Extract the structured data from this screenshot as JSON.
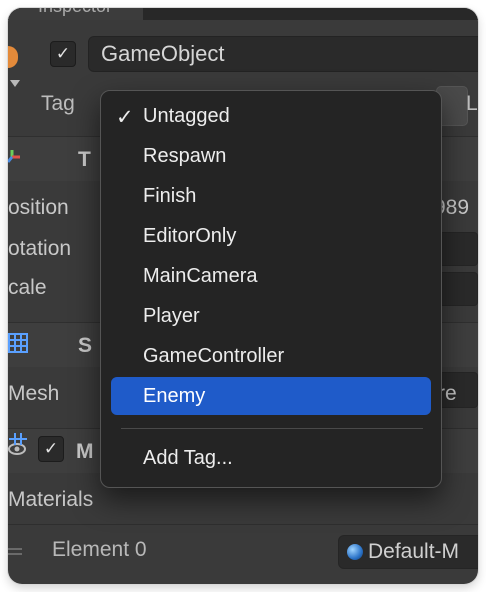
{
  "window": {
    "title": "Inspector"
  },
  "header": {
    "active_checked": "✓",
    "name": "GameObject",
    "tag_label": "Tag",
    "layer_label": "L"
  },
  "transform": {
    "header_label": "T",
    "position_label": "osition",
    "position_value": "989",
    "rotation_label": "otation",
    "scale_label": "cale"
  },
  "mesh_filter": {
    "header_label": "S",
    "mesh_label": "Mesh",
    "mesh_value": "re"
  },
  "mesh_renderer": {
    "enabled_checked": "✓",
    "header_label": "M",
    "materials_label": "Materials",
    "element_label": "Element 0",
    "element_value": "Default-M"
  },
  "tag_dropdown": {
    "checkmark": "✓",
    "items": [
      "Untagged",
      "Respawn",
      "Finish",
      "EditorOnly",
      "MainCamera",
      "Player",
      "GameController",
      "Enemy"
    ],
    "checked_item": "Untagged",
    "highlighted_item": "Enemy",
    "add_tag": "Add Tag..."
  },
  "colors": {
    "panel_bg": "#3a3a3a",
    "dropdown_bg": "#242424",
    "highlight": "#1f5bc9",
    "object_icon": "#e38a3a",
    "component_icon": "#5aa0ff"
  }
}
